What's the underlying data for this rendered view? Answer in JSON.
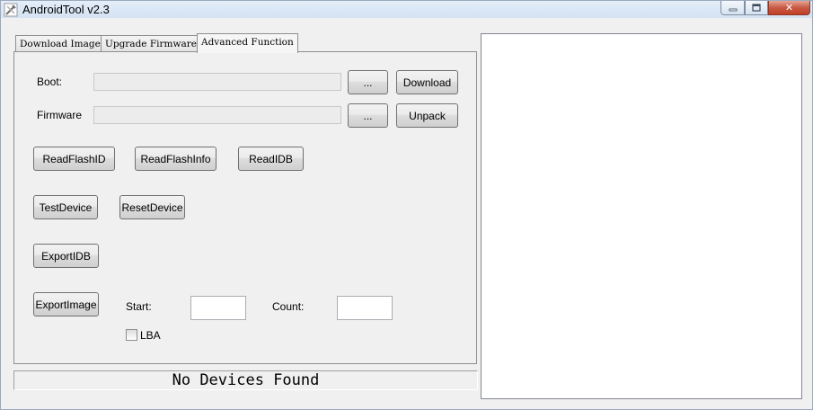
{
  "window": {
    "title": "AndroidTool v2.3",
    "close_symbol": "✕"
  },
  "tabs": [
    {
      "label": "Download Image"
    },
    {
      "label": "Upgrade Firmware"
    },
    {
      "label": "Advanced Function"
    }
  ],
  "advanced": {
    "boot_label": "Boot:",
    "boot_value": "",
    "boot_browse_label": "...",
    "download_label": "Download",
    "firmware_label": "Firmware",
    "firmware_value": "",
    "firmware_browse_label": "...",
    "unpack_label": "Unpack",
    "read_flash_id_label": "ReadFlashID",
    "read_flash_info_label": "ReadFlashInfo",
    "read_idb_label": "ReadIDB",
    "test_device_label": "TestDevice",
    "reset_device_label": "ResetDevice",
    "export_idb_label": "ExportIDB",
    "export_image_label": "ExportImage",
    "start_label": "Start:",
    "start_value": "",
    "count_label": "Count:",
    "count_value": "",
    "lba_label": "LBA",
    "lba_checked": false
  },
  "status": {
    "text": "No Devices Found"
  },
  "icons": {
    "app": "android-tool-icon",
    "minimize": "minimize-icon",
    "maximize": "maximize-icon",
    "close": "close-icon"
  }
}
